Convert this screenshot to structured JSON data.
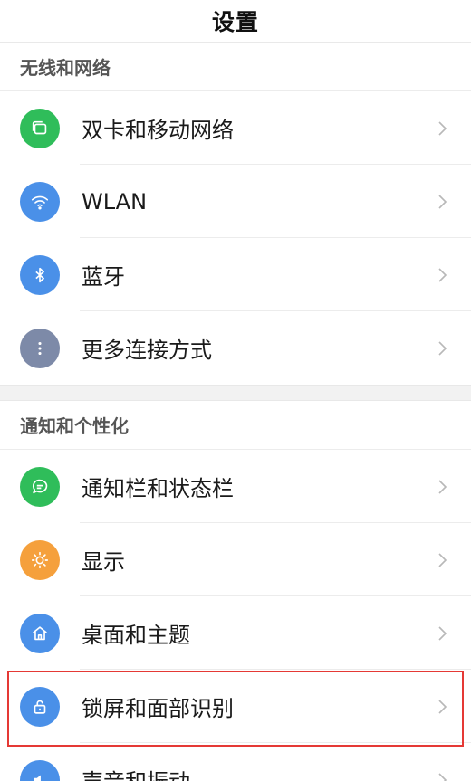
{
  "title": "设置",
  "colors": {
    "green": "#2fbd5a",
    "blue": "#4a90e8",
    "slate": "#7d8aa8",
    "orange": "#f5a03c",
    "highlight": "#e53935"
  },
  "sections": [
    {
      "header": "无线和网络",
      "items": [
        {
          "label": "双卡和移动网络",
          "icon": "sim-cards-icon"
        },
        {
          "label": "WLAN",
          "icon": "wifi-icon"
        },
        {
          "label": "蓝牙",
          "icon": "bluetooth-icon"
        },
        {
          "label": "更多连接方式",
          "icon": "more-dots-icon"
        }
      ]
    },
    {
      "header": "通知和个性化",
      "items": [
        {
          "label": "通知栏和状态栏",
          "icon": "chat-bubble-icon"
        },
        {
          "label": "显示",
          "icon": "brightness-icon"
        },
        {
          "label": "桌面和主题",
          "icon": "home-icon"
        },
        {
          "label": "锁屏和面部识别",
          "icon": "lock-icon"
        },
        {
          "label": "声音和振动",
          "icon": "sound-icon"
        }
      ]
    }
  ]
}
